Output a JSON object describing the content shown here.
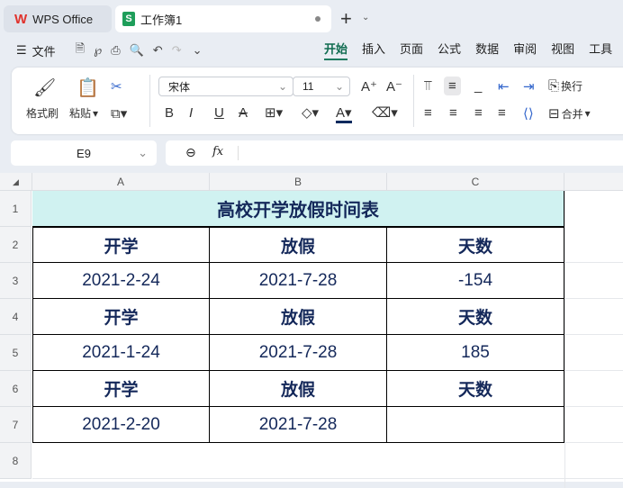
{
  "tabs": [
    {
      "label": "WPS Office"
    },
    {
      "label": "工作簿1"
    }
  ],
  "menu": {
    "file": "文件",
    "ribbon_tabs": [
      "开始",
      "插入",
      "页面",
      "公式",
      "数据",
      "审阅",
      "视图",
      "工具"
    ]
  },
  "ribbon": {
    "format_painter": "格式刷",
    "paste": "粘贴",
    "font": "宋体",
    "size": "11",
    "wrap": "换行",
    "merge": "合并"
  },
  "formula": {
    "name_box": "E9",
    "fx": "fx",
    "value": ""
  },
  "sheet": {
    "columns": [
      "A",
      "B",
      "C"
    ],
    "rows": [
      "1",
      "2",
      "3",
      "4",
      "5",
      "6",
      "7",
      "8"
    ],
    "title": "高校开学放假时间表",
    "data": [
      [
        "开学",
        "放假",
        "天数"
      ],
      [
        "2021-2-24",
        "2021-7-28",
        "-154"
      ],
      [
        "开学",
        "放假",
        "天数"
      ],
      [
        "2021-1-24",
        "2021-7-28",
        "185"
      ],
      [
        "开学",
        "放假",
        "天数"
      ],
      [
        "2021-2-20",
        "2021-7-28",
        ""
      ]
    ],
    "title_fill": "#d0f2f1"
  }
}
